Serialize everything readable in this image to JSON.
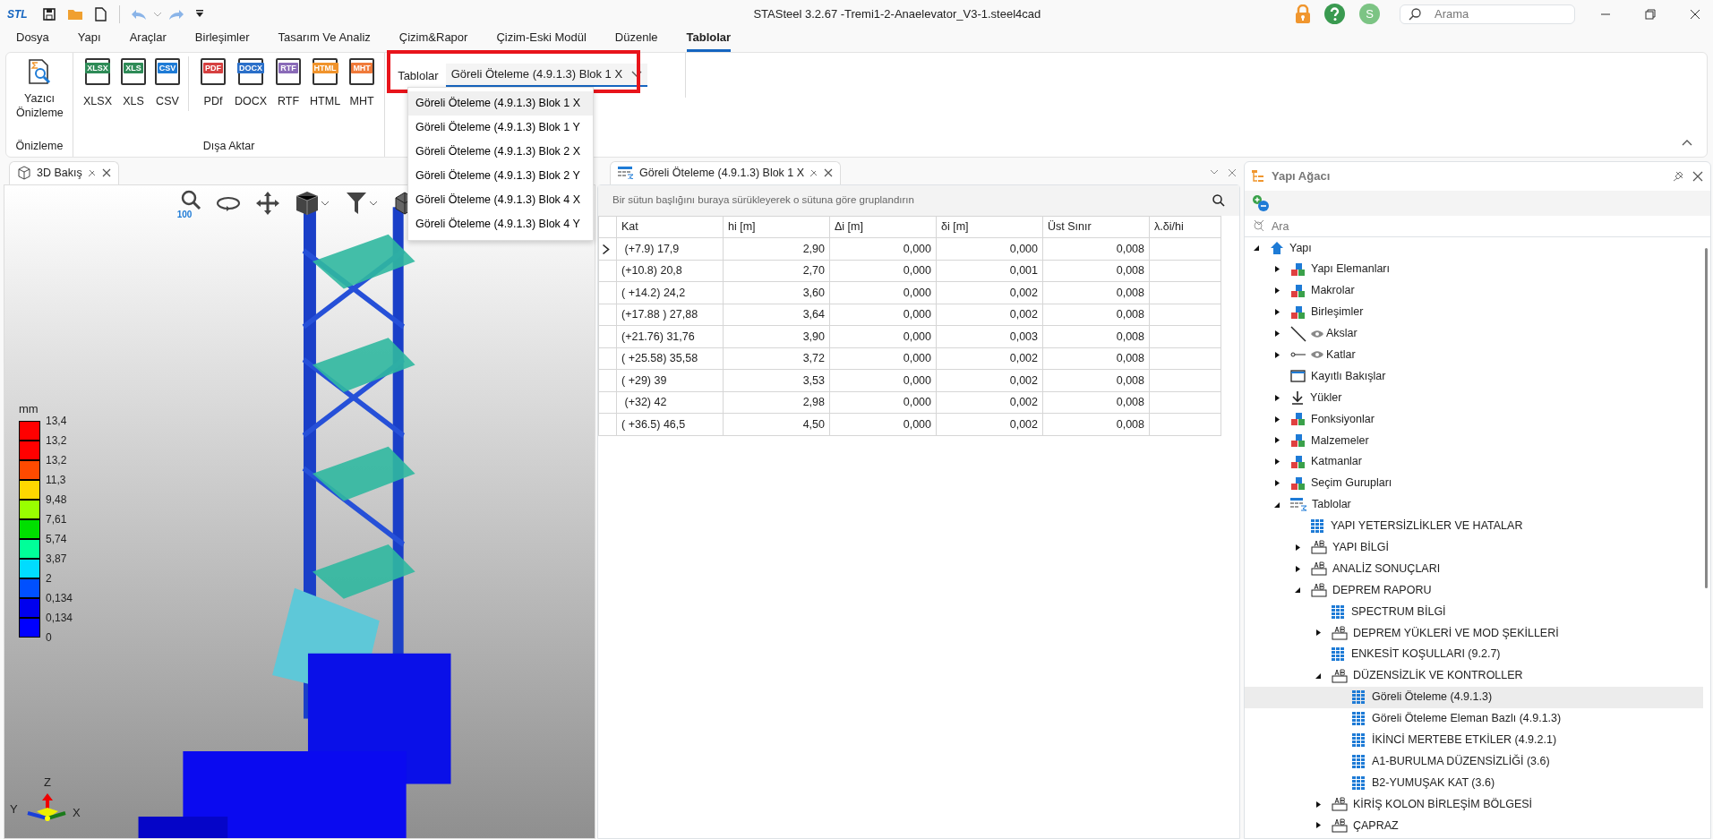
{
  "title_bar": {
    "logo": "STL",
    "title": "STASteel 3.2.67 -Tremi1-2-Anaelevator_V3-1.steel4cad",
    "avatar": "S",
    "search_placeholder": "Arama"
  },
  "menu_tabs": [
    {
      "label": "Dosya",
      "selected": false
    },
    {
      "label": "Yapı",
      "selected": false
    },
    {
      "label": "Araçlar",
      "selected": false
    },
    {
      "label": "Birleşimler",
      "selected": false
    },
    {
      "label": "Tasarım Ve Analiz",
      "selected": false
    },
    {
      "label": "Çizim&Rapor",
      "selected": false
    },
    {
      "label": "Çizim-Eski Modül",
      "selected": false
    },
    {
      "label": "Düzenle",
      "selected": false
    },
    {
      "label": "Tablolar",
      "selected": true
    }
  ],
  "ribbon": {
    "groups": [
      {
        "label": "Önizleme",
        "sections": [
          [
            {
              "label": "Yazıcı Önizleme",
              "kind": "preview"
            }
          ]
        ]
      },
      {
        "label": "Dışa Aktar",
        "sections": [
          [
            {
              "label": "XLSX",
              "kind": "file",
              "badge": "XLSX",
              "color": "#2e8b57"
            },
            {
              "label": "XLS",
              "kind": "file",
              "badge": "XLS",
              "color": "#2e8b57"
            },
            {
              "label": "CSV",
              "kind": "file",
              "badge": "CSV",
              "color": "#1e7bd6"
            }
          ],
          [
            {
              "label": "PDf",
              "kind": "file",
              "badge": "PDF",
              "color": "#d64040"
            },
            {
              "label": "DOCX",
              "kind": "file",
              "badge": "DOCX",
              "color": "#2a6fc9"
            },
            {
              "label": "RTF",
              "kind": "file",
              "badge": "RTF",
              "color": "#8a6bb8"
            },
            {
              "label": "HTML",
              "kind": "file",
              "badge": "HTML",
              "color": "#f0932b"
            },
            {
              "label": "MHT",
              "kind": "file",
              "badge": "MHT",
              "color": "#f07a3a"
            }
          ]
        ]
      }
    ],
    "tables_combo": {
      "label": "Tablolar",
      "value": "Göreli Öteleme (4.9.1.3) Blok 1 X",
      "expanded": true,
      "options": [
        {
          "label": "Göreli Öteleme (4.9.1.3) Blok 1 X",
          "selected": true
        },
        {
          "label": "Göreli Öteleme (4.9.1.3) Blok 1 Y",
          "selected": false
        },
        {
          "label": "Göreli Öteleme (4.9.1.3) Blok 2 X",
          "selected": false
        },
        {
          "label": "Göreli Öteleme (4.9.1.3) Blok 2 Y",
          "selected": false
        },
        {
          "label": "Göreli Öteleme (4.9.1.3) Blok 4 X",
          "selected": false
        },
        {
          "label": "Göreli Öteleme (4.9.1.3) Blok 4 Y",
          "selected": false
        }
      ]
    }
  },
  "view_3d": {
    "tab_title": "3D Bakış",
    "zoom_label": "100",
    "legend": {
      "unit": "mm",
      "labels": [
        "13,4",
        "13,2",
        "13,2",
        "11,3",
        "9,48",
        "7,61",
        "5,74",
        "3,87",
        "2",
        "0,134",
        "0,134",
        "0"
      ],
      "colors": [
        {
          "color": "#ff0000"
        },
        {
          "color": "#ff0000"
        },
        {
          "color": "#ff4a00"
        },
        {
          "color": "#ffd800"
        },
        {
          "color": "#99ff00"
        },
        {
          "color": "#00e000"
        },
        {
          "color": "#00ff99"
        },
        {
          "color": "#00dcff"
        },
        {
          "color": "#0050ff"
        },
        {
          "color": "#0000ee"
        },
        {
          "color": "#0000ff"
        }
      ]
    },
    "axes": {
      "z": "Z",
      "y": "Y",
      "x": "X"
    }
  },
  "table_panel": {
    "tab_title": "Göreli Öteleme (4.9.1.3) Blok 1 X",
    "group_hint": "Bir sütun başlığını buraya sürükleyerek o sütuna göre gruplandırın",
    "columns": [
      "Kat",
      "hi [m]",
      "Δi [m]",
      "δi [m]",
      "Üst Sınır",
      "λ.δi/hi"
    ],
    "rows": [
      {
        "current": true,
        "cells": [
          " (+7.9) 17,9",
          "2,90",
          "0,000",
          "0,000",
          "0,008",
          ""
        ]
      },
      {
        "current": false,
        "cells": [
          "(+10.8) 20,8",
          "2,70",
          "0,000",
          "0,001",
          "0,008",
          ""
        ]
      },
      {
        "current": false,
        "cells": [
          "( +14.2) 24,2",
          "3,60",
          "0,000",
          "0,002",
          "0,008",
          ""
        ]
      },
      {
        "current": false,
        "cells": [
          "(+17.88 ) 27,88",
          "3,64",
          "0,000",
          "0,002",
          "0,008",
          ""
        ]
      },
      {
        "current": false,
        "cells": [
          "(+21.76) 31,76",
          "3,90",
          "0,000",
          "0,003",
          "0,008",
          ""
        ]
      },
      {
        "current": false,
        "cells": [
          "( +25.58) 35,58",
          "3,72",
          "0,000",
          "0,002",
          "0,008",
          ""
        ]
      },
      {
        "current": false,
        "cells": [
          "( +29) 39",
          "3,53",
          "0,000",
          "0,002",
          "0,008",
          ""
        ]
      },
      {
        "current": false,
        "cells": [
          " (+32) 42",
          "2,98",
          "0,000",
          "0,002",
          "0,008",
          ""
        ]
      },
      {
        "current": false,
        "cells": [
          "( +36.5) 46,5",
          "4,50",
          "0,000",
          "0,002",
          "0,008",
          ""
        ]
      }
    ]
  },
  "tree_panel": {
    "title": "Yapı Ağacı",
    "search_placeholder": "Ara",
    "items": [
      {
        "label": "Yapı",
        "kind": "home",
        "expanded": true,
        "selected": false,
        "children": [
          {
            "label": "Yapı Elemanları",
            "kind": "blocks",
            "expanded": false,
            "selected": false
          },
          {
            "label": "Makrolar",
            "kind": "blocks",
            "expanded": false,
            "selected": false
          },
          {
            "label": "Birleşimler",
            "kind": "blocks",
            "expanded": false,
            "selected": false
          },
          {
            "label": "Akslar",
            "kind": "axis",
            "expanded": false,
            "selected": false,
            "visible": true
          },
          {
            "label": "Katlar",
            "kind": "level",
            "expanded": false,
            "selected": false,
            "visible": true
          },
          {
            "label": "Kayıtlı Bakışlar",
            "kind": "window",
            "selected": false
          },
          {
            "label": "Yükler",
            "kind": "load",
            "expanded": false,
            "selected": false
          },
          {
            "label": "Fonksiyonlar",
            "kind": "blocks",
            "expanded": false,
            "selected": false
          },
          {
            "label": "Malzemeler",
            "kind": "blocks",
            "expanded": false,
            "selected": false
          },
          {
            "label": "Katmanlar",
            "kind": "blocks",
            "expanded": false,
            "selected": false
          },
          {
            "label": "Seçim Gurupları",
            "kind": "blocks",
            "expanded": false,
            "selected": false
          },
          {
            "label": "Tablolar",
            "kind": "tables",
            "expanded": true,
            "selected": false,
            "children": [
              {
                "label": "YAPI YETERSİZLİKLER VE HATALAR",
                "kind": "grid",
                "selected": false
              },
              {
                "label": "YAPI BİLGİ",
                "kind": "ab",
                "expanded": false,
                "selected": false
              },
              {
                "label": "ANALİZ SONUÇLARI",
                "kind": "ab",
                "expanded": false,
                "selected": false
              },
              {
                "label": "DEPREM RAPORU",
                "kind": "ab",
                "expanded": true,
                "selected": false,
                "children": [
                  {
                    "label": "SPECTRUM BİLGİ",
                    "kind": "grid",
                    "selected": false
                  },
                  {
                    "label": "DEPREM YÜKLERİ VE MOD ŞEKİLLERİ",
                    "kind": "ab",
                    "expanded": false,
                    "selected": false
                  },
                  {
                    "label": "ENKESİT KOŞULLARI (9.2.7)",
                    "kind": "grid",
                    "selected": false
                  },
                  {
                    "label": "DÜZENSİZLİK VE KONTROLLER",
                    "kind": "ab",
                    "expanded": true,
                    "selected": false,
                    "children": [
                      {
                        "label": "Göreli Öteleme (4.9.1.3)",
                        "kind": "grid",
                        "selected": true
                      },
                      {
                        "label": "Göreli Öteleme Eleman Bazlı (4.9.1.3)",
                        "kind": "grid",
                        "selected": false
                      },
                      {
                        "label": "İKİNCİ MERTEBE ETKİLER (4.9.2.1)",
                        "kind": "grid",
                        "selected": false
                      },
                      {
                        "label": "A1-BURULMA DÜZENSİZLİĞİ (3.6)",
                        "kind": "grid",
                        "selected": false
                      },
                      {
                        "label": "B2-YUMUŞAK KAT (3.6)",
                        "kind": "grid",
                        "selected": false
                      }
                    ]
                  },
                  {
                    "label": "KİRİŞ KOLON BİRLEŞİM BÖLGESİ",
                    "kind": "ab",
                    "expanded": false,
                    "selected": false
                  },
                  {
                    "label": "ÇAPRAZ",
                    "kind": "ab",
                    "expanded": false,
                    "selected": false
                  }
                ]
              }
            ]
          }
        ]
      }
    ]
  }
}
